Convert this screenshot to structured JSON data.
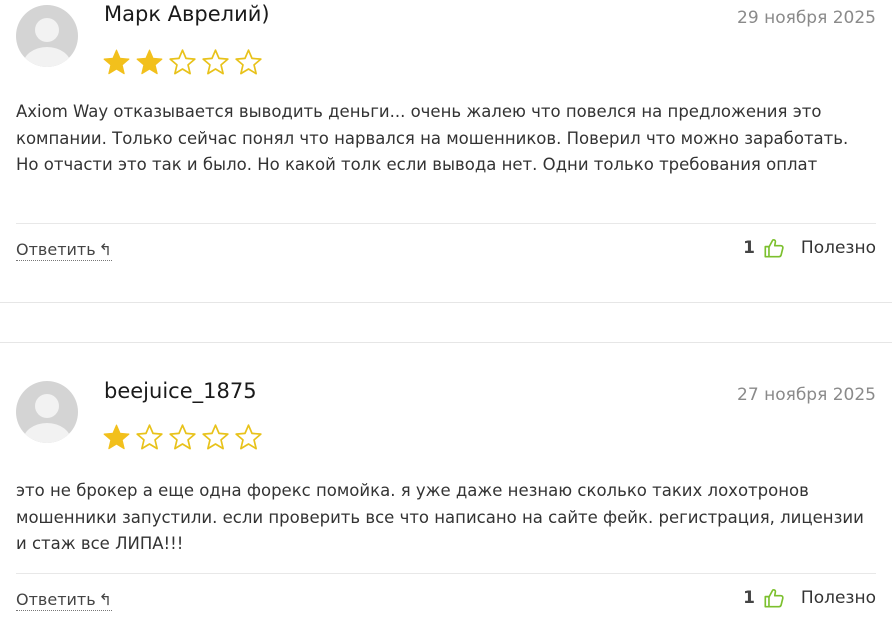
{
  "reviews": [
    {
      "author": "Марк Аврелий)",
      "date": "29 ноября 2025",
      "rating": 2,
      "max_rating": 5,
      "text": "Axiom Way отказывается выводить деньги... очень жалею что повелся на предложения это компании. Только сейчас понял что нарвался на мошенников. Поверил что можно заработать. Но отчасти это так и было. Но какой толк если вывода нет. Одни только требования оплат",
      "reply_label": "Ответить",
      "reply_icon": "↰",
      "useful_count": "1",
      "useful_label": "Полезно"
    },
    {
      "author": "beejuice_1875",
      "date": "27 ноября 2025",
      "rating": 1,
      "max_rating": 5,
      "text": "это не брокер а еще одна форекс помойка. я уже даже незнаю сколько таких лохотронов мошенники запустили. если проверить все что написано на сайте фейк. регистрация, лицензии и стаж все ЛИПА!!!",
      "reply_label": "Ответить",
      "reply_icon": "↰",
      "useful_count": "1",
      "useful_label": "Полезно"
    }
  ],
  "colors": {
    "star_filled": "#f2c01c",
    "star_empty_stroke": "#e8c21a",
    "thumb_green": "#7cc02e",
    "avatar_bg": "#d4d4d4",
    "avatar_fg": "#f2f2f2"
  }
}
